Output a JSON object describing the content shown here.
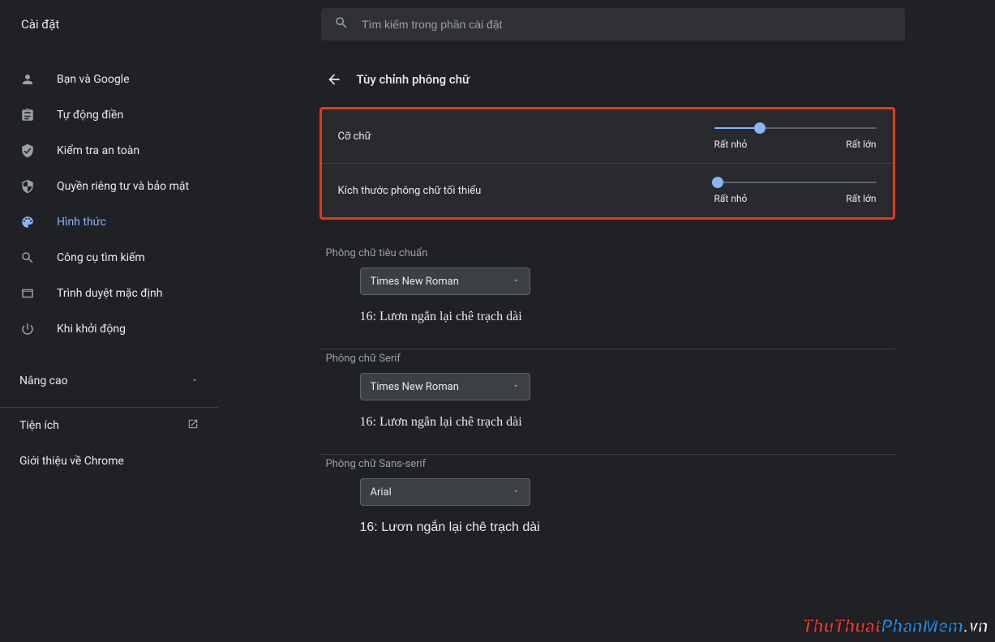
{
  "app_title": "Cài đặt",
  "search": {
    "placeholder": "Tìm kiếm trong phần cài đặt"
  },
  "sidebar": {
    "items": [
      {
        "label": "Bạn và Google"
      },
      {
        "label": "Tự động điền"
      },
      {
        "label": "Kiểm tra an toàn"
      },
      {
        "label": "Quyền riêng tư và bảo mật"
      },
      {
        "label": "Hình thức"
      },
      {
        "label": "Công cụ tìm kiếm"
      },
      {
        "label": "Trình duyệt mặc định"
      },
      {
        "label": "Khi khởi động"
      }
    ],
    "advanced": "Nâng cao",
    "extensions": "Tiện ích",
    "about": "Giới thiệu về Chrome"
  },
  "page": {
    "title": "Tùy chỉnh phông chữ",
    "sliders": {
      "font_size": {
        "label": "Cỡ chữ",
        "min_label": "Rất nhỏ",
        "max_label": "Rất lớn",
        "percent": 28
      },
      "min_font_size": {
        "label": "Kích thước phông chữ tối thiểu",
        "min_label": "Rất nhỏ",
        "max_label": "Rất lớn",
        "percent": 2
      }
    },
    "fonts": {
      "standard": {
        "title": "Phông chữ tiêu chuẩn",
        "selected": "Times New Roman",
        "preview": "16: Lươn ngắn lại chê trạch dài"
      },
      "serif": {
        "title": "Phông chữ Serif",
        "selected": "Times New Roman",
        "preview": "16: Lươn ngắn lại chê trạch dài"
      },
      "sans": {
        "title": "Phông chữ Sans-serif",
        "selected": "Arial",
        "preview": "16: Lươn ngắn lại chê trạch dài"
      }
    }
  },
  "watermark": {
    "part1": "ThuThuat",
    "part2": "PhanMem",
    "part3": ".vn"
  }
}
